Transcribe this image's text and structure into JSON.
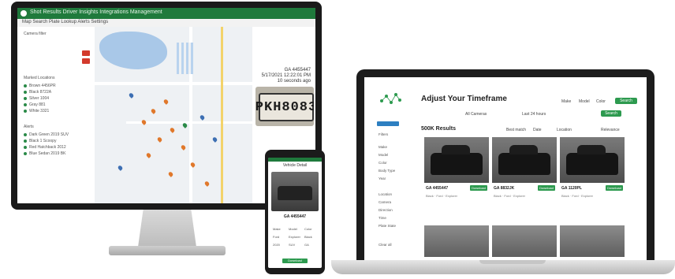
{
  "desktop": {
    "topbar_text": "Shot Results  Driver Insights  Integrations  Management",
    "subnav_text": "Map Search  Plate Lookup  Alerts  Settings",
    "plate_text": "PKH8083",
    "info_lines": [
      "GA 4455447",
      "5/17/2021 12:22:01 PM",
      "10 seconds ago"
    ],
    "sidebar_rows": [
      "Camera filter",
      "Marked Locations",
      "Brown 4456PR",
      "Black 8722A",
      "Silver 1004",
      "Gray 881",
      "White 3321",
      "Alerts",
      "Dark Green 2019 SUV",
      "Black 1 Scoopy",
      "Red Hatchback 2012",
      "Blue Sedan 2019 BK"
    ]
  },
  "phone": {
    "header": "Vehicle Detail",
    "plate": "GA 4455447",
    "button": "Download",
    "grid": [
      "Make",
      "Model",
      "Color",
      "Ford",
      "Explorer",
      "Black",
      "2020",
      "SUV",
      "GA"
    ]
  },
  "laptop": {
    "title": "Adjust Your Timeframe",
    "filters": [
      "All Cameras",
      "Last 24 hours",
      "Make",
      "Model",
      "Color"
    ],
    "search_btn": "Search",
    "results_label": "500K Results",
    "sort_labels": [
      "Best match",
      "Date",
      "Location",
      "Relevance"
    ],
    "sidebar_rows": [
      "Filters",
      "Make",
      "Model",
      "Color",
      "Body Type",
      "Year",
      "Location",
      "Camera",
      "Direction",
      "Time",
      "Plate State",
      "Clear all"
    ],
    "cards": [
      {
        "plate": "GA 4455447",
        "button": "Download",
        "meta": "Black · Ford · Explorer"
      },
      {
        "plate": "GA 8832JK",
        "button": "Download",
        "meta": "Black · Ford · Explorer"
      },
      {
        "plate": "GA 1120PL",
        "button": "Download",
        "meta": "Black · Ford · Explorer"
      }
    ]
  }
}
